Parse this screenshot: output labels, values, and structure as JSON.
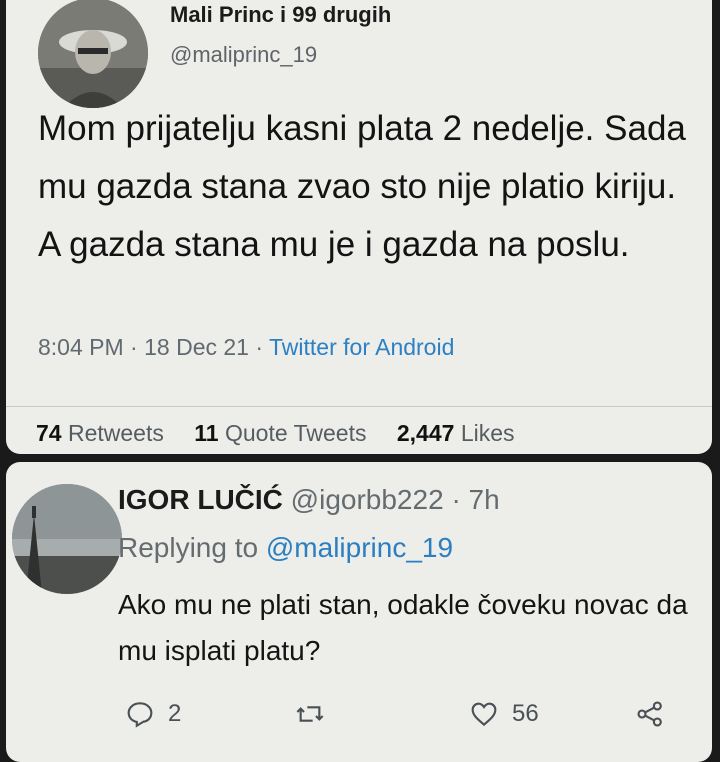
{
  "tweet": {
    "display_name": "Mali Princ i 99 drugih",
    "handle": "@maliprinc_19",
    "text": "Mom prijatelju kasni plata 2 nedelje. Sada mu gazda stana zvao sto nije platio kiriju. A gazda stana mu je i gazda na poslu.",
    "time": "8:04 PM",
    "date": "18 Dec 21",
    "source": "Twitter for Android",
    "stats": {
      "retweets_count": "74",
      "retweets_label": "Retweets",
      "quotes_count": "11",
      "quotes_label": "Quote Tweets",
      "likes_count": "2,447",
      "likes_label": "Likes"
    }
  },
  "reply": {
    "display_name": "IGOR LUČIĆ",
    "handle": "@igorbb222",
    "age": "7h",
    "replying_prefix": "Replying to",
    "replying_to": "@maliprinc_19",
    "text": "Ako mu ne plati stan, odakle čoveku novac da mu isplati platu?",
    "actions": {
      "reply_count": "2",
      "like_count": "56"
    }
  },
  "separator": "·",
  "icons": [
    "reply-icon",
    "retweet-icon",
    "like-icon",
    "share-icon"
  ]
}
